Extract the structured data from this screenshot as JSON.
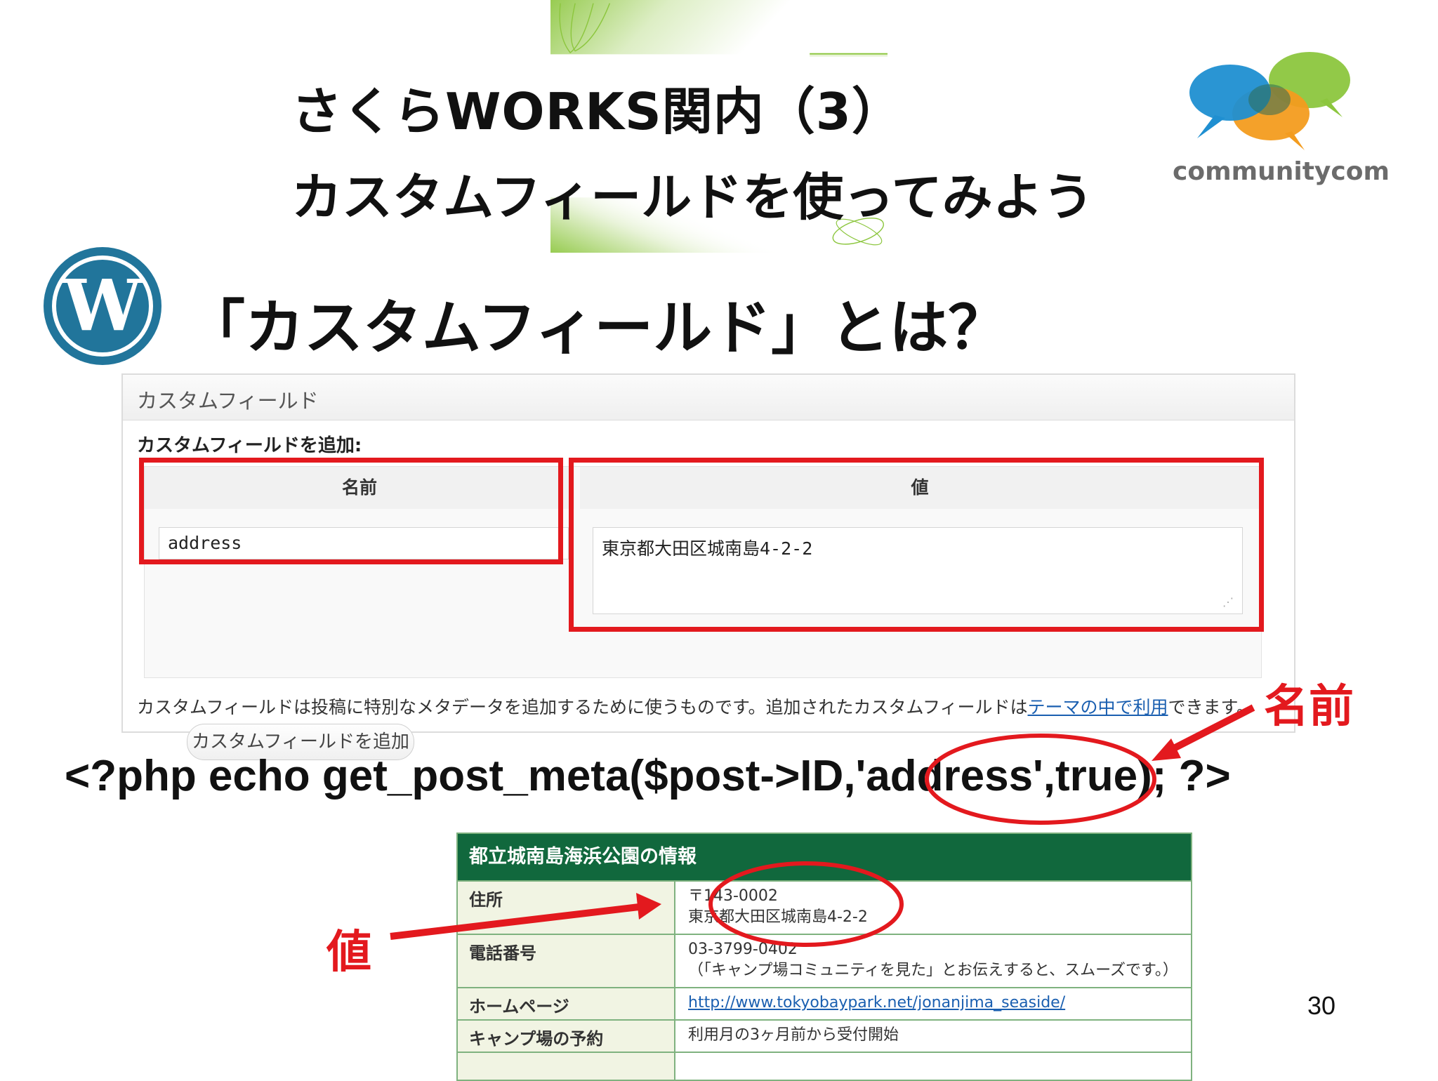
{
  "slide": {
    "title_line1": "さくらWORKS関内（3）",
    "title_line2": "カスタムフィールドを使ってみよう",
    "heading": "「カスタムフィールド」とは？",
    "brand": "communitycom",
    "page_number": "30"
  },
  "custom_field_panel": {
    "title": "カスタムフィールド",
    "subtitle": "カスタムフィールドを追加:",
    "col_name": "名前",
    "col_value": "値",
    "name_value": "address",
    "value_value": "東京都大田区城南島4-2-2",
    "add_button": "カスタムフィールドを追加",
    "note_before": "カスタムフィールドは投稿に特別なメタデータを追加するために使うものです。追加されたカスタムフィールドは",
    "note_link": "テーマの中で利用",
    "note_after": "できます。"
  },
  "annotations": {
    "name_label": "名前",
    "value_label": "値"
  },
  "code_line": "<?php echo get_post_meta($post->ID,'address',true); ?>",
  "info_table": {
    "title": "都立城南島海浜公園の情報",
    "rows": [
      {
        "key": "住所",
        "line1": "〒143-0002",
        "line2": "東京都大田区城南島4-2-2"
      },
      {
        "key": "電話番号",
        "line1": "03-3799-0402",
        "line2": "（「キャンプ場コミュニティを見た」とお伝えすると、スムーズです。）"
      },
      {
        "key": "ホームページ",
        "line1": "http://www.tokyobaypark.net/jonanjima_seaside/",
        "line2": ""
      },
      {
        "key": "キャンプ場の予約",
        "line1": "利用月の3ヶ月前から受付開始",
        "line2": ""
      }
    ]
  },
  "colors": {
    "accent_green": "#8cc63e",
    "annotation_red": "#e3191e",
    "table_header_green": "#11683d",
    "wordpress_blue": "#21759b"
  }
}
